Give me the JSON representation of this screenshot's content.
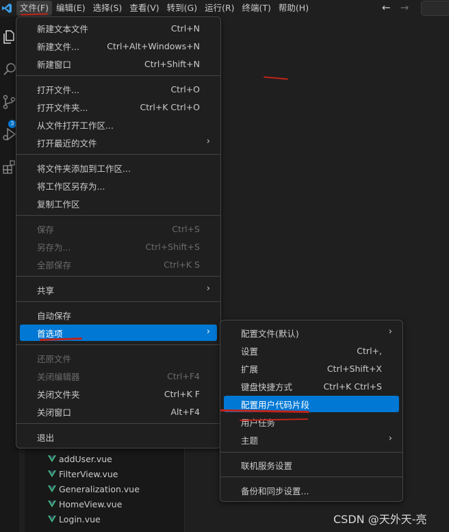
{
  "menubar": {
    "items": [
      {
        "label": "文件(F)",
        "active": true
      },
      {
        "label": "编辑(E)",
        "active": false
      },
      {
        "label": "选择(S)",
        "active": false
      },
      {
        "label": "查看(V)",
        "active": false
      },
      {
        "label": "转到(G)",
        "active": false
      },
      {
        "label": "运行(R)",
        "active": false
      },
      {
        "label": "终端(T)",
        "active": false
      },
      {
        "label": "帮助(H)",
        "active": false
      }
    ],
    "back_arrow": "←",
    "forward_arrow": "→"
  },
  "activity_bar": {
    "icons": [
      "files-icon",
      "search-icon",
      "source-control-icon",
      "run-debug-icon",
      "extensions-icon"
    ],
    "source_control_badge": "3"
  },
  "explorer": {
    "files": [
      "addUser.vue",
      "FilterView.vue",
      "Generalization.vue",
      "HomeView.vue",
      "Login.vue"
    ]
  },
  "file_menu": {
    "items": [
      {
        "label": "新建文本文件",
        "shortcut": "Ctrl+N"
      },
      {
        "label": "新建文件...",
        "shortcut": "Ctrl+Alt+Windows+N"
      },
      {
        "label": "新建窗口",
        "shortcut": "Ctrl+Shift+N"
      },
      {
        "label": "打开文件...",
        "shortcut": "Ctrl+O"
      },
      {
        "label": "打开文件夹...",
        "shortcut": "Ctrl+K Ctrl+O"
      },
      {
        "label": "从文件打开工作区...",
        "shortcut": ""
      },
      {
        "label": "打开最近的文件",
        "shortcut": ""
      },
      {
        "label": "将文件夹添加到工作区...",
        "shortcut": ""
      },
      {
        "label": "将工作区另存为...",
        "shortcut": ""
      },
      {
        "label": "复制工作区",
        "shortcut": ""
      },
      {
        "label": "保存",
        "shortcut": "Ctrl+S"
      },
      {
        "label": "另存为...",
        "shortcut": "Ctrl+Shift+S"
      },
      {
        "label": "全部保存",
        "shortcut": "Ctrl+K S"
      },
      {
        "label": "共享",
        "shortcut": ""
      },
      {
        "label": "自动保存",
        "shortcut": ""
      },
      {
        "label": "首选项",
        "shortcut": ""
      },
      {
        "label": "还原文件",
        "shortcut": ""
      },
      {
        "label": "关闭编辑器",
        "shortcut": "Ctrl+F4"
      },
      {
        "label": "关闭文件夹",
        "shortcut": "Ctrl+K F"
      },
      {
        "label": "关闭窗口",
        "shortcut": "Alt+F4"
      },
      {
        "label": "退出",
        "shortcut": ""
      }
    ]
  },
  "preferences_submenu": {
    "items": [
      {
        "label": "配置文件(默认)",
        "shortcut": ""
      },
      {
        "label": "设置",
        "shortcut": "Ctrl+,"
      },
      {
        "label": "扩展",
        "shortcut": "Ctrl+Shift+X"
      },
      {
        "label": "键盘快捷方式",
        "shortcut": "Ctrl+K Ctrl+S"
      },
      {
        "label": "配置用户代码片段",
        "shortcut": ""
      },
      {
        "label": "用户任务",
        "shortcut": ""
      },
      {
        "label": "主题",
        "shortcut": ""
      },
      {
        "label": "联机服务设置",
        "shortcut": ""
      },
      {
        "label": "备份和同步设置...",
        "shortcut": ""
      }
    ]
  },
  "submenu_arrow": "›",
  "watermark": "CSDN @天外天-亮",
  "colors": {
    "highlight": "#0078d4",
    "annotation": "#c02418",
    "vue_green": "#41b883"
  }
}
